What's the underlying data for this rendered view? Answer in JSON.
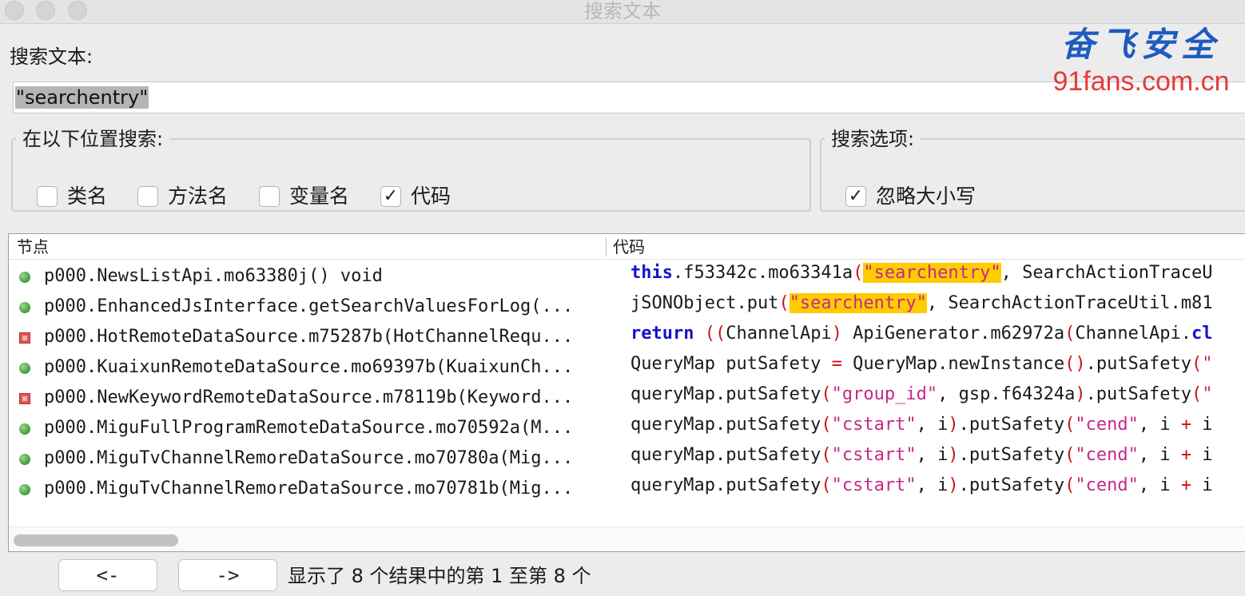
{
  "window": {
    "title": "搜索文本"
  },
  "search": {
    "label": "搜索文本:",
    "value": "\"searchentry\""
  },
  "watermark": {
    "name": "奋飞安全",
    "url": "91fans.com.cn"
  },
  "search_in": {
    "legend": "在以下位置搜索:",
    "options": [
      {
        "label": "类名",
        "checked": false
      },
      {
        "label": "方法名",
        "checked": false
      },
      {
        "label": "变量名",
        "checked": false
      },
      {
        "label": "代码",
        "checked": true
      }
    ]
  },
  "search_options": {
    "legend": "搜索选项:",
    "options": [
      {
        "label": "忽略大小写",
        "checked": true
      }
    ]
  },
  "results": {
    "columns": [
      "节点",
      "代码"
    ],
    "rows": [
      {
        "icon": "method-icon",
        "node": "p000.NewsListApi.mo63380j() void",
        "code": [
          [
            "kw",
            "this"
          ],
          [
            "t",
            ".f53342c.mo63341a"
          ],
          [
            "pn",
            "("
          ],
          [
            "hl",
            "\"searchentry\""
          ],
          [
            "t",
            ", SearchActionTraceU"
          ]
        ]
      },
      {
        "icon": "method-icon",
        "node": "p000.EnhancedJsInterface.getSearchValuesForLog(...",
        "code": [
          [
            "t",
            "jSONObject.put"
          ],
          [
            "pn",
            "("
          ],
          [
            "hl",
            "\"searchentry\""
          ],
          [
            "t",
            ", SearchActionTraceUtil.m81"
          ]
        ]
      },
      {
        "icon": "private-method-icon",
        "node": "p000.HotRemoteDataSource.m75287b(HotChannelRequ...",
        "code": [
          [
            "kw",
            "return"
          ],
          [
            "t",
            " "
          ],
          [
            "pn",
            "(("
          ],
          [
            "t",
            "ChannelApi"
          ],
          [
            "pn",
            ")"
          ],
          [
            "t",
            " ApiGenerator.m62972a"
          ],
          [
            "pn",
            "("
          ],
          [
            "t",
            "ChannelApi."
          ],
          [
            "kw",
            "cl"
          ]
        ]
      },
      {
        "icon": "method-icon",
        "node": "p000.KuaixunRemoteDataSource.mo69397b(KuaixunCh...",
        "code": [
          [
            "t",
            "QueryMap putSafety "
          ],
          [
            "op",
            "="
          ],
          [
            "t",
            " QueryMap.newInstance"
          ],
          [
            "pn",
            "()"
          ],
          [
            "t",
            ".putSafety"
          ],
          [
            "pn",
            "("
          ],
          [
            "str",
            "\""
          ]
        ]
      },
      {
        "icon": "private-method-icon",
        "node": "p000.NewKeywordRemoteDataSource.m78119b(Keyword...",
        "code": [
          [
            "t",
            "queryMap.putSafety"
          ],
          [
            "pn",
            "("
          ],
          [
            "str",
            "\"group_id\""
          ],
          [
            "t",
            ", gsp.f64324a"
          ],
          [
            "pn",
            ")"
          ],
          [
            "t",
            ".putSafety"
          ],
          [
            "pn",
            "("
          ],
          [
            "str",
            "\""
          ]
        ]
      },
      {
        "icon": "method-icon",
        "node": "p000.MiguFullProgramRemoteDataSource.mo70592a(M...",
        "code": [
          [
            "t",
            "queryMap.putSafety"
          ],
          [
            "pn",
            "("
          ],
          [
            "str",
            "\"cstart\""
          ],
          [
            "t",
            ", i"
          ],
          [
            "pn",
            ")"
          ],
          [
            "t",
            ".putSafety"
          ],
          [
            "pn",
            "("
          ],
          [
            "str",
            "\"cend\""
          ],
          [
            "t",
            ", i "
          ],
          [
            "op",
            "+"
          ],
          [
            "t",
            " i"
          ]
        ]
      },
      {
        "icon": "method-icon",
        "node": "p000.MiguTvChannelRemoreDataSource.mo70780a(Mig...",
        "code": [
          [
            "t",
            "queryMap.putSafety"
          ],
          [
            "pn",
            "("
          ],
          [
            "str",
            "\"cstart\""
          ],
          [
            "t",
            ", i"
          ],
          [
            "pn",
            ")"
          ],
          [
            "t",
            ".putSafety"
          ],
          [
            "pn",
            "("
          ],
          [
            "str",
            "\"cend\""
          ],
          [
            "t",
            ", i "
          ],
          [
            "op",
            "+"
          ],
          [
            "t",
            " i"
          ]
        ]
      },
      {
        "icon": "method-icon",
        "node": "p000.MiguTvChannelRemoreDataSource.mo70781b(Mig...",
        "code": [
          [
            "t",
            "queryMap.putSafety"
          ],
          [
            "pn",
            "("
          ],
          [
            "str",
            "\"cstart\""
          ],
          [
            "t",
            ", i"
          ],
          [
            "pn",
            ")"
          ],
          [
            "t",
            ".putSafety"
          ],
          [
            "pn",
            "("
          ],
          [
            "str",
            "\"cend\""
          ],
          [
            "t",
            ", i "
          ],
          [
            "op",
            "+"
          ],
          [
            "t",
            " i"
          ]
        ]
      }
    ]
  },
  "nav": {
    "prev_label": "<-",
    "next_label": "->"
  },
  "status": "显示了 8 个结果中的第 1 至第 8 个"
}
